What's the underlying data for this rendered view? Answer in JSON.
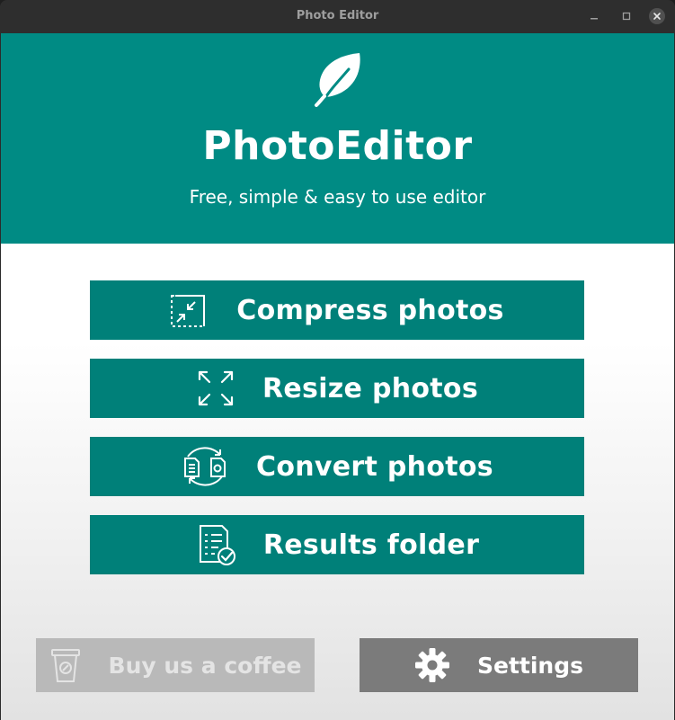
{
  "window": {
    "title": "Photo Editor",
    "controls": [
      "minimize-icon",
      "maximize-icon",
      "close-icon"
    ]
  },
  "header": {
    "logo_icon": "leaf-icon",
    "app_name": "PhotoEditor",
    "tagline": "Free, simple & easy to use editor",
    "background_color": "#008b84"
  },
  "actions": [
    {
      "label": "Compress photos",
      "icon": "compress-icon"
    },
    {
      "label": "Resize photos",
      "icon": "resize-arrows-icon"
    },
    {
      "label": "Convert photos",
      "icon": "convert-files-icon"
    },
    {
      "label": "Results folder",
      "icon": "results-document-icon"
    }
  ],
  "footer": {
    "coffee": {
      "label": "Buy us a coffee",
      "icon": "coffee-cup-icon",
      "state": "disabled"
    },
    "settings": {
      "label": "Settings",
      "icon": "gear-icon"
    }
  },
  "colors": {
    "accent": "#008079",
    "coffee_button": "#b9b9b9",
    "settings_button": "#7b7b7b"
  }
}
